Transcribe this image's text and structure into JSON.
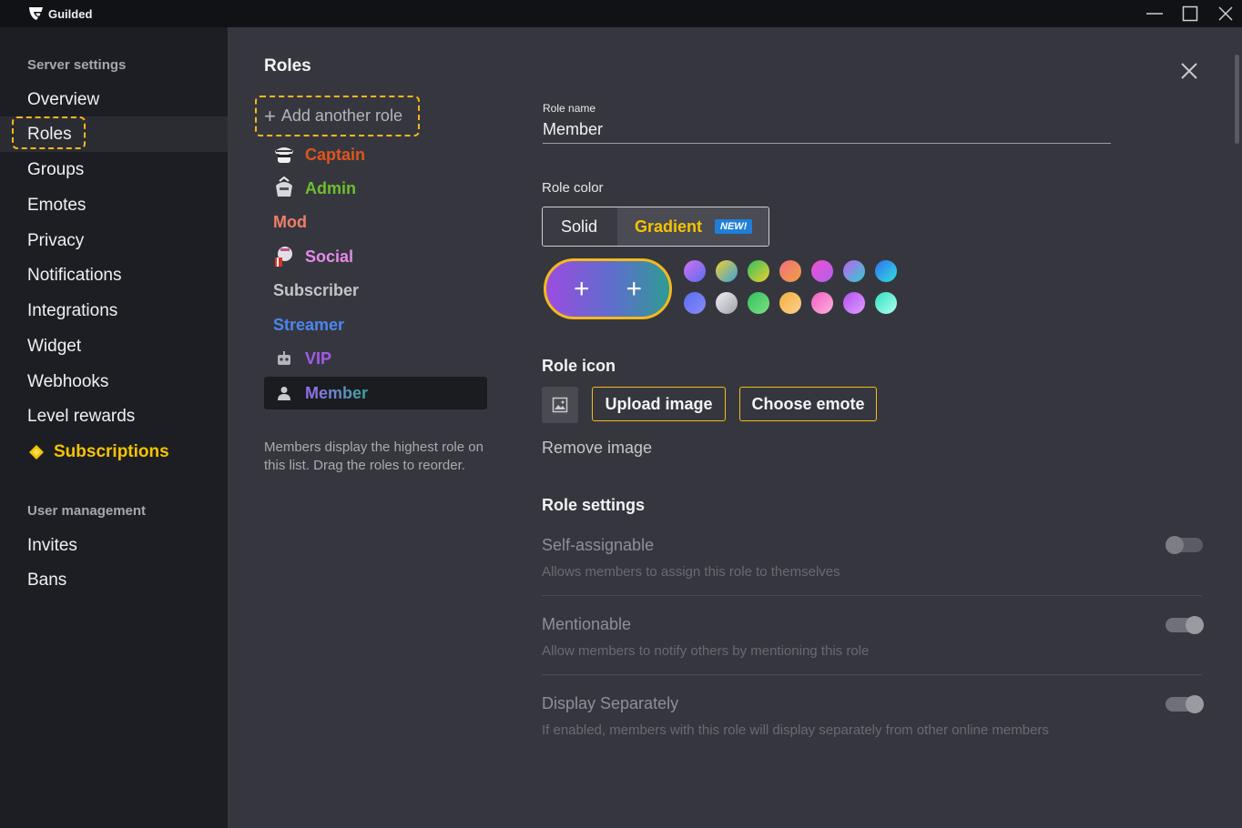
{
  "app": {
    "title": "Guilded"
  },
  "sidebar": {
    "section_server": "Server settings",
    "items": [
      {
        "label": "Overview"
      },
      {
        "label": "Roles"
      },
      {
        "label": "Groups"
      },
      {
        "label": "Emotes"
      },
      {
        "label": "Privacy"
      },
      {
        "label": "Notifications"
      },
      {
        "label": "Integrations"
      },
      {
        "label": "Widget"
      },
      {
        "label": "Webhooks"
      },
      {
        "label": "Level rewards"
      },
      {
        "label": "Subscriptions"
      }
    ],
    "section_users": "User management",
    "user_items": [
      {
        "label": "Invites"
      },
      {
        "label": "Bans"
      }
    ]
  },
  "roles_panel": {
    "title": "Roles",
    "add_role_label": "Add another role",
    "roles": [
      {
        "label": "Captain",
        "color": "#e2541b"
      },
      {
        "label": "Admin",
        "color": "#6fbf2e"
      },
      {
        "label": "Mod",
        "color": "#f07d6b"
      },
      {
        "label": "Social",
        "color": "#e58be8"
      },
      {
        "label": "Subscriber",
        "color": "#c3c4c9"
      },
      {
        "label": "Streamer",
        "color": "#4b86f0"
      },
      {
        "label": "VIP",
        "color": "#a35ae8"
      },
      {
        "label": "Member",
        "color": "#8d74e0"
      }
    ],
    "hint": "Members display the highest role on this list. Drag the roles to reorder."
  },
  "editor": {
    "role_name_label": "Role name",
    "role_name_value": "Member",
    "role_color_label": "Role color",
    "tab_solid": "Solid",
    "tab_gradient": "Gradient",
    "badge_new": "NEW!",
    "role_icon_label": "Role icon",
    "upload_image": "Upload image",
    "choose_emote": "Choose emote",
    "remove_image": "Remove image",
    "role_settings_label": "Role settings",
    "settings": [
      {
        "title": "Self-assignable",
        "desc": "Allows members to assign this role to themselves",
        "enabled": false
      },
      {
        "title": "Mentionable",
        "desc": "Allow members to notify others by mentioning this role",
        "enabled": true
      },
      {
        "title": "Display Separately",
        "desc": "If enabled, members with this role will display separately from other online members",
        "enabled": true
      }
    ]
  },
  "colors": {
    "accent": "#f5b91e",
    "subscriptions": "#f5c400"
  }
}
